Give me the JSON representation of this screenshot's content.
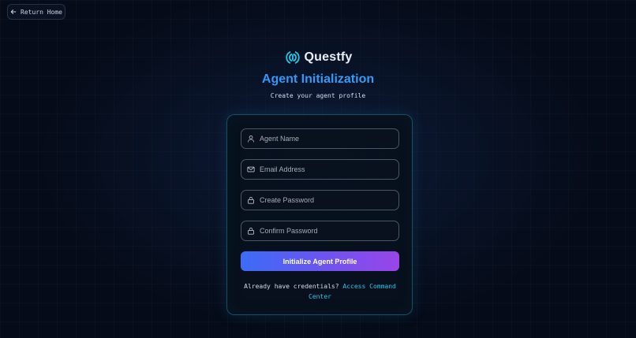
{
  "nav": {
    "return_label": "Return Home",
    "return_icon": "arrow-left-icon"
  },
  "brand": {
    "name": "Questfy",
    "logo_icon": "questfy-logo-icon",
    "logo_color": "#22c7e8"
  },
  "header": {
    "title": "Agent Initialization",
    "subtitle": "Create your agent profile"
  },
  "form": {
    "fields": [
      {
        "placeholder": "Agent Name",
        "value": "",
        "icon": "user-icon"
      },
      {
        "placeholder": "Email Address",
        "value": "",
        "icon": "mail-icon"
      },
      {
        "placeholder": "Create Password",
        "value": "",
        "icon": "lock-icon"
      },
      {
        "placeholder": "Confirm Password",
        "value": "",
        "icon": "lock-icon"
      }
    ],
    "submit_label": "Initialize Agent Profile",
    "footer_prompt": "Already have credentials?",
    "footer_link": "Access Command Center"
  },
  "colors": {
    "accent_cyan": "#22c7e8",
    "title_gradient_start": "#3b82f6",
    "title_gradient_end": "#2bb3ff",
    "button_gradient_start": "#3b6df6",
    "button_gradient_end": "#9a45e8",
    "background": "#050b18"
  }
}
